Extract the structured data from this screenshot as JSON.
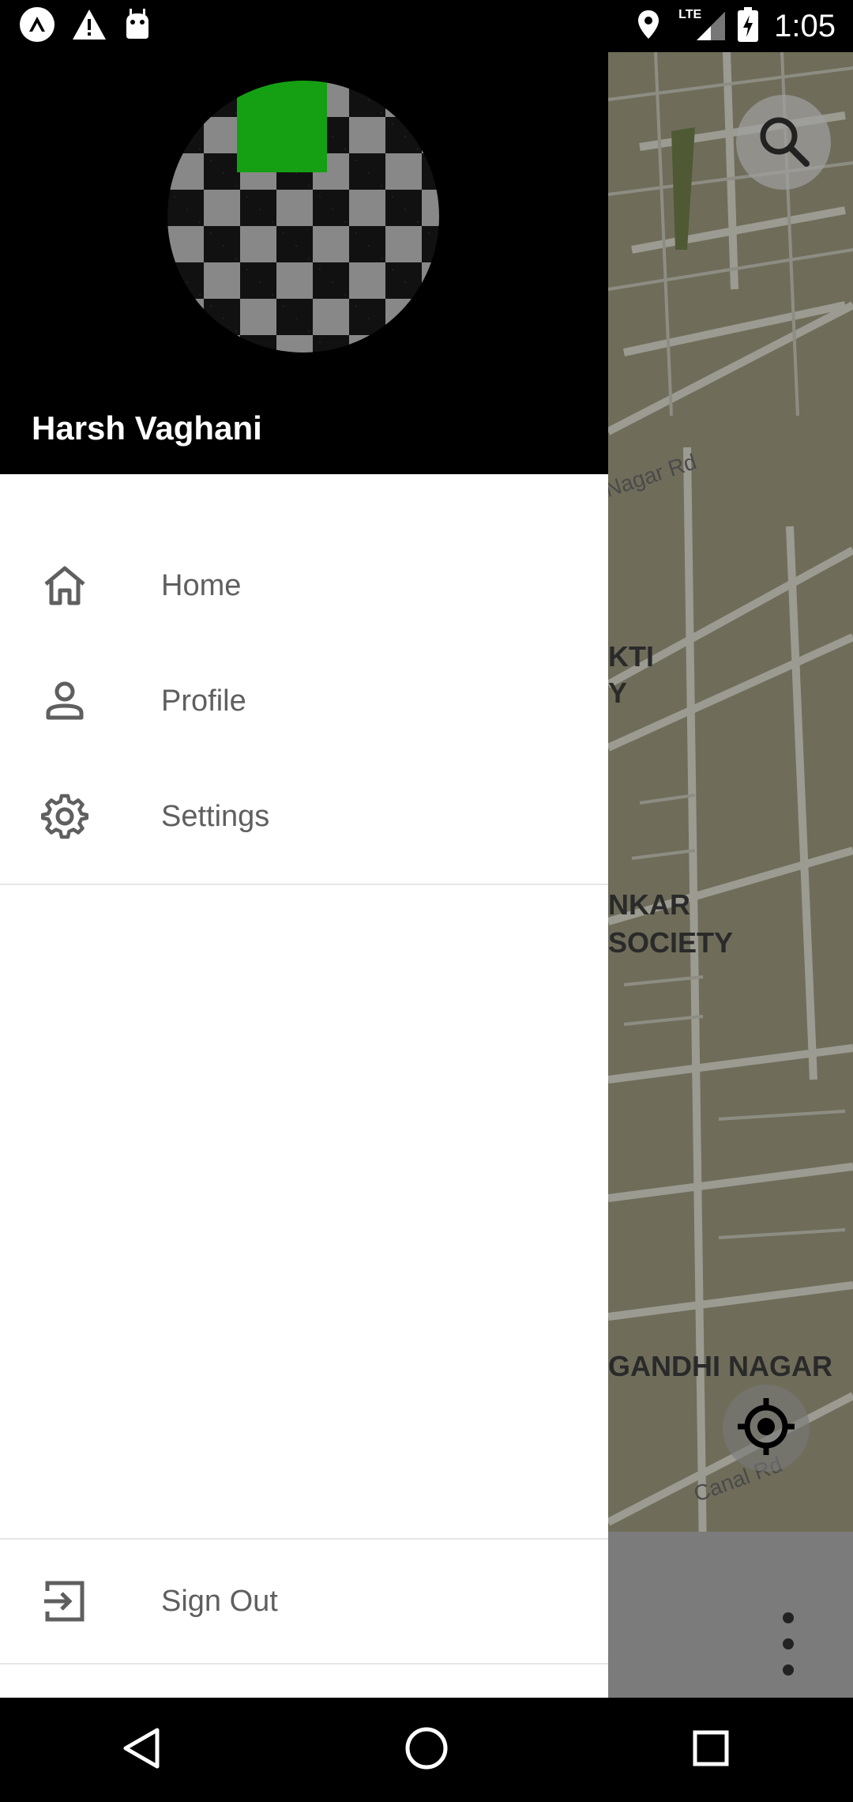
{
  "status_bar": {
    "time": "1:05",
    "network": "LTE",
    "icons": [
      "expo-icon",
      "warning-icon",
      "android-icon",
      "location-icon",
      "signal-icon",
      "battery-icon"
    ]
  },
  "drawer": {
    "user_name": "Harsh Vaghani",
    "items": [
      {
        "label": "Home",
        "icon": "home-icon"
      },
      {
        "label": "Profile",
        "icon": "person-icon"
      },
      {
        "label": "Settings",
        "icon": "gear-icon"
      }
    ],
    "sign_out_label": "Sign Out"
  },
  "map": {
    "labels": [
      "Nagar Rd",
      "KTI",
      "Y",
      "NKAR",
      "SOCIETY",
      "GANDHI NAGAR",
      "Canal Rd"
    ]
  },
  "colors": {
    "map_bg": "#6f6d5a",
    "avatar_green": "#14a012",
    "menu_text": "#5f5f5f"
  }
}
